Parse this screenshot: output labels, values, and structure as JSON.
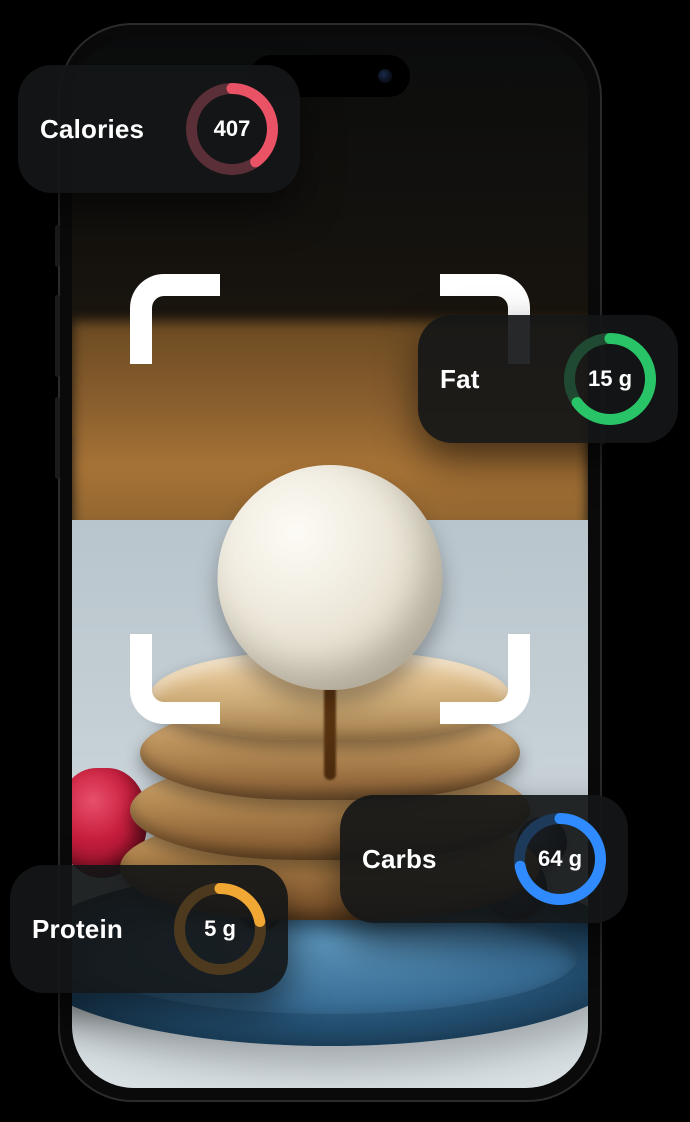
{
  "metrics": {
    "calories": {
      "label": "Calories",
      "value": "407",
      "percent": 40,
      "color": "#ea5366",
      "track": "#5a2f37"
    },
    "fat": {
      "label": "Fat",
      "value": "15 g",
      "percent": 65,
      "color": "#29c467",
      "track": "#1f4a31"
    },
    "carbs": {
      "label": "Carbs",
      "value": "64 g",
      "percent": 72,
      "color": "#2f8bff",
      "track": "#1e3a5a"
    },
    "protein": {
      "label": "Protein",
      "value": "5 g",
      "percent": 22,
      "color": "#f0a733",
      "track": "#4d3a1e"
    }
  }
}
